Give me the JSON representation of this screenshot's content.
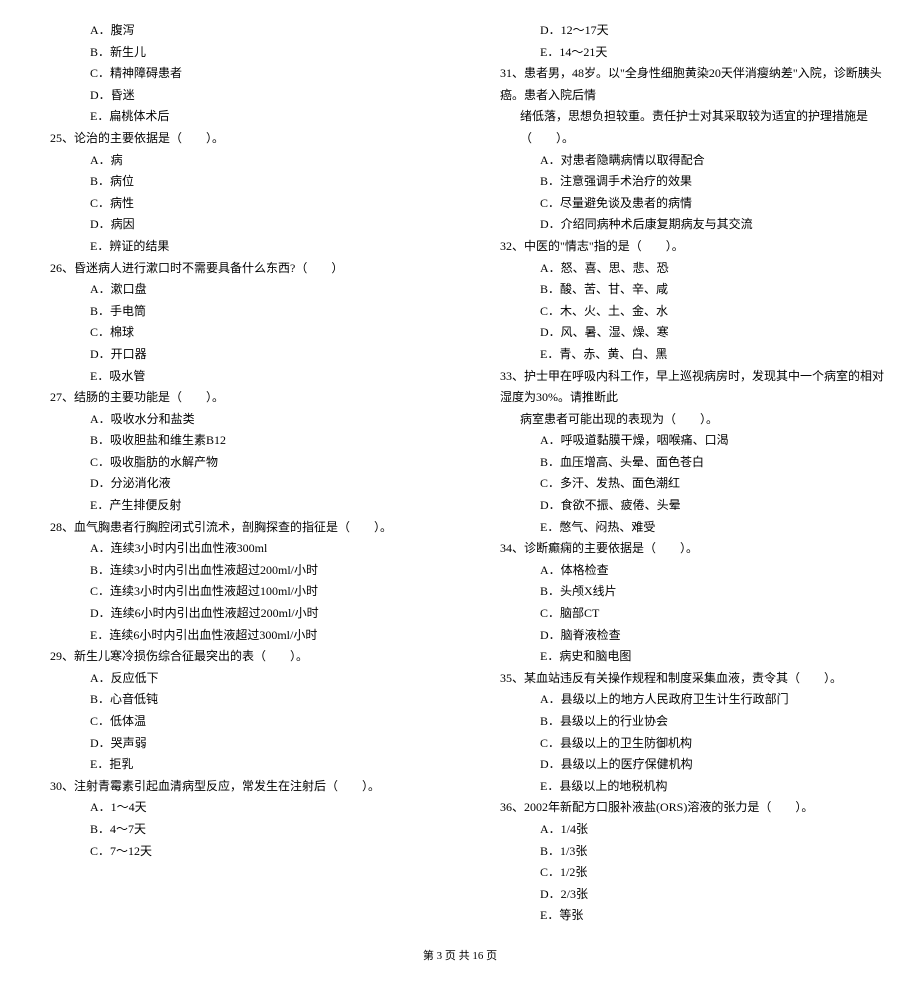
{
  "left": {
    "opts24": [
      "A．腹泻",
      "B．新生儿",
      "C．精神障碍患者",
      "D．昏迷",
      "E．扁桃体术后"
    ],
    "q25": "25、论治的主要依据是（　　）。",
    "opts25": [
      "A．病",
      "B．病位",
      "C．病性",
      "D．病因",
      "E．辨证的结果"
    ],
    "q26": "26、昏迷病人进行漱口时不需要具备什么东西?（　　）",
    "opts26": [
      "A．漱口盘",
      "B．手电筒",
      "C．棉球",
      "D．开口器",
      "E．吸水管"
    ],
    "q27": "27、结肠的主要功能是（　　）。",
    "opts27": [
      "A．吸收水分和盐类",
      "B．吸收胆盐和维生素B12",
      "C．吸收脂肪的水解产物",
      "D．分泌消化液",
      "E．产生排便反射"
    ],
    "q28": "28、血气胸患者行胸腔闭式引流术，剖胸探查的指征是（　　）。",
    "opts28": [
      "A．连续3小时内引出血性液300ml",
      "B．连续3小时内引出血性液超过200ml/小时",
      "C．连续3小时内引出血性液超过100ml/小时",
      "D．连续6小时内引出血性液超过200ml/小时",
      "E．连续6小时内引出血性液超过300ml/小时"
    ],
    "q29": "29、新生儿寒冷损伤综合征最突出的表（　　）。",
    "opts29": [
      "A．反应低下",
      "B．心音低钝",
      "C．低体温",
      "D．哭声弱",
      "E．拒乳"
    ],
    "q30": "30、注射青霉素引起血清病型反应，常发生在注射后（　　）。",
    "opts30": [
      "A．1～4天",
      "B．4～7天",
      "C．7～12天"
    ]
  },
  "right": {
    "opts30b": [
      "D．12～17天",
      "E．14～21天"
    ],
    "q31a": "31、患者男，48岁。以\"全身性细胞黄染20天伴消瘦纳差\"入院，诊断胰头癌。患者入院后情",
    "q31b": "绪低落，思想负担较重。责任护士对其采取较为适宜的护理措施是（　　）。",
    "opts31": [
      "A．对患者隐瞒病情以取得配合",
      "B．注意强调手术治疗的效果",
      "C．尽量避免谈及患者的病情",
      "D．介绍同病种术后康复期病友与其交流"
    ],
    "q32": "32、中医的\"情志\"指的是（　　）。",
    "opts32": [
      "A．怒、喜、思、悲、恐",
      "B．酸、苦、甘、辛、咸",
      "C．木、火、土、金、水",
      "D．风、暑、湿、燥、寒",
      "E．青、赤、黄、白、黑"
    ],
    "q33a": "33、护士甲在呼吸内科工作，早上巡视病房时，发现其中一个病室的相对湿度为30%。请推断此",
    "q33b": "病室患者可能出现的表现为（　　）。",
    "opts33": [
      "A．呼吸道黏膜干燥，咽喉痛、口渴",
      "B．血压增高、头晕、面色苍白",
      "C．多汗、发热、面色潮红",
      "D．食欲不振、疲倦、头晕",
      "E．憋气、闷热、难受"
    ],
    "q34": "34、诊断癫痫的主要依据是（　　）。",
    "opts34": [
      "A．体格检查",
      "B．头颅X线片",
      "C．脑部CT",
      "D．脑脊液检查",
      "E．病史和脑电图"
    ],
    "q35": "35、某血站违反有关操作规程和制度采集血液，责令其（　　）。",
    "opts35": [
      "A．县级以上的地方人民政府卫生计生行政部门",
      "B．县级以上的行业协会",
      "C．县级以上的卫生防御机构",
      "D．县级以上的医疗保健机构",
      "E．县级以上的地税机构"
    ],
    "q36": "36、2002年新配方口服补液盐(ORS)溶液的张力是（　　）。",
    "opts36": [
      "A．1/4张",
      "B．1/3张",
      "C．1/2张",
      "D．2/3张",
      "E．等张"
    ]
  },
  "footer": "第 3 页 共 16 页"
}
